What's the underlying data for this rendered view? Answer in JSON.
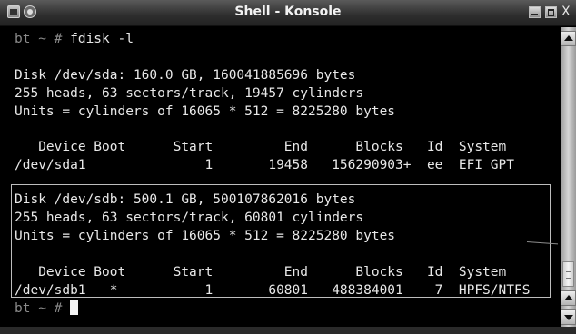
{
  "window": {
    "title": "Shell - Konsole",
    "close_glyph": "X"
  },
  "terminal": {
    "prompt_1": "bt ~ # ",
    "command_1": "fdisk -l",
    "sda_disk": "Disk /dev/sda: 160.0 GB, 160041885696 bytes",
    "sda_geometry": "255 heads, 63 sectors/track, 19457 cylinders",
    "sda_units": "Units = cylinders of 16065 * 512 = 8225280 bytes",
    "sda_header": "   Device Boot      Start         End      Blocks   Id  System",
    "sda_part1": "/dev/sda1               1       19458   156290903+  ee  EFI GPT",
    "sdb_disk": "Disk /dev/sdb: 500.1 GB, 500107862016 bytes",
    "sdb_geometry": "255 heads, 63 sectors/track, 60801 cylinders",
    "sdb_units": "Units = cylinders of 16065 * 512 = 8225280 bytes",
    "sdb_header": "   Device Boot      Start         End      Blocks   Id  System",
    "sdb_part1": "/dev/sdb1   *           1       60801   488384001    7  HPFS/NTFS",
    "prompt_2": "bt ~ # "
  }
}
